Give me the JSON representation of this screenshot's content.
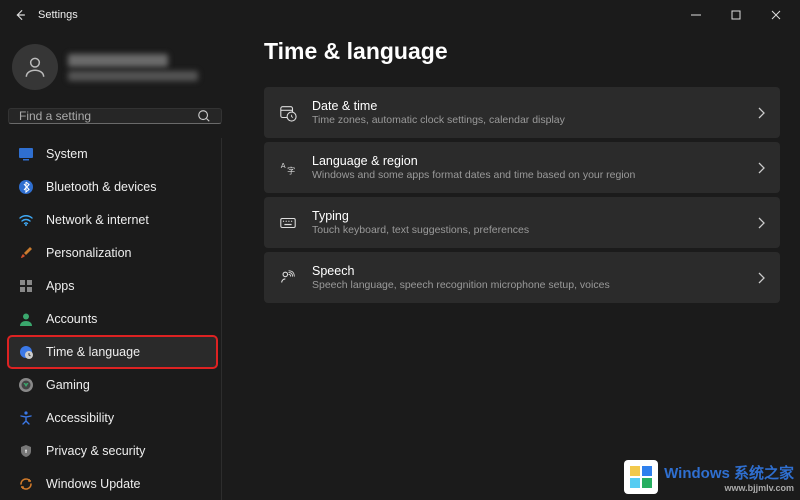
{
  "titlebar": {
    "title": "Settings"
  },
  "profile": {
    "name": "",
    "email": ""
  },
  "search": {
    "placeholder": "Find a setting"
  },
  "sidebar": {
    "items": [
      {
        "label": "System"
      },
      {
        "label": "Bluetooth & devices"
      },
      {
        "label": "Network & internet"
      },
      {
        "label": "Personalization"
      },
      {
        "label": "Apps"
      },
      {
        "label": "Accounts"
      },
      {
        "label": "Time & language"
      },
      {
        "label": "Gaming"
      },
      {
        "label": "Accessibility"
      },
      {
        "label": "Privacy & security"
      },
      {
        "label": "Windows Update"
      }
    ]
  },
  "main": {
    "title": "Time & language",
    "cards": [
      {
        "title": "Date & time",
        "desc": "Time zones, automatic clock settings, calendar display"
      },
      {
        "title": "Language & region",
        "desc": "Windows and some apps format dates and time based on your region"
      },
      {
        "title": "Typing",
        "desc": "Touch keyboard, text suggestions, preferences"
      },
      {
        "title": "Speech",
        "desc": "Speech language, speech recognition microphone setup, voices"
      }
    ]
  },
  "watermark": {
    "brand": "Windows 系统之家",
    "url": "www.bjjmlv.com"
  }
}
